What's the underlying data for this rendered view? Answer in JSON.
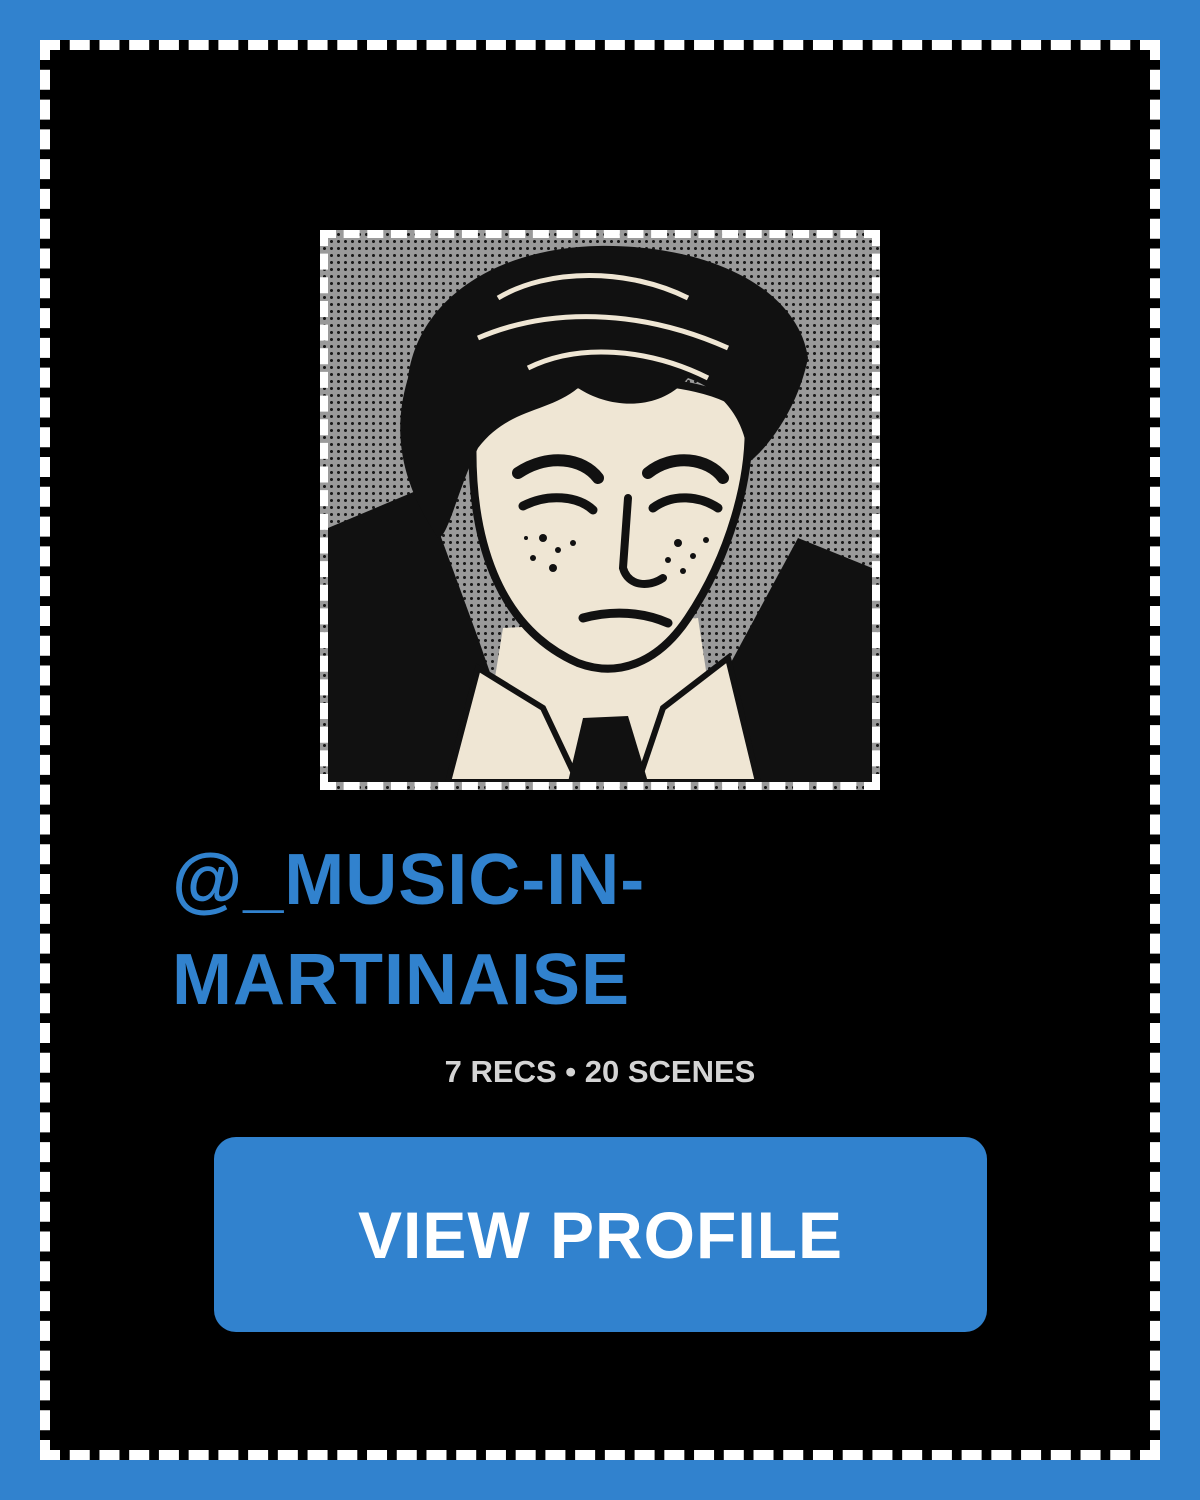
{
  "profile": {
    "username": "@_MUSIC-IN-MARTINAISE",
    "stats": "7 RECS • 20 SCENES",
    "avatar_alt": "avatar"
  },
  "actions": {
    "view_profile_label": "VIEW PROFILE"
  },
  "colors": {
    "accent": "#3182ce",
    "card_background": "#000000",
    "border": "#ffffff",
    "stats_text": "#d4d4d4"
  }
}
